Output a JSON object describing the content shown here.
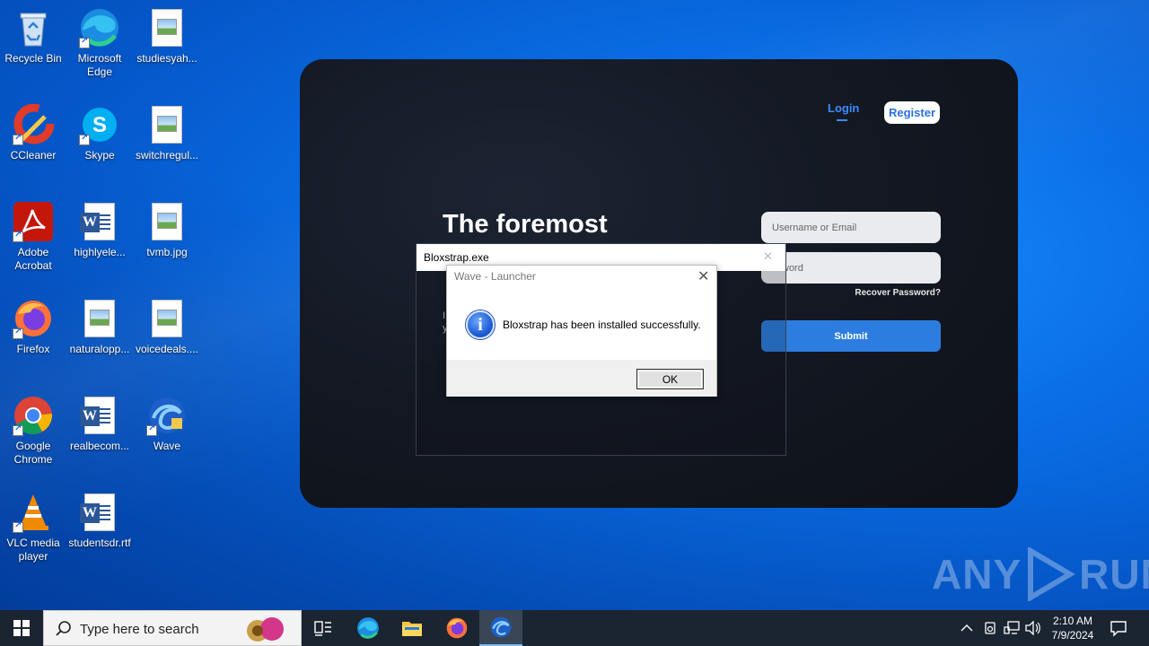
{
  "desktop": {
    "icons": [
      {
        "label": "Recycle Bin"
      },
      {
        "label": "Microsoft Edge"
      },
      {
        "label": "studiesyah..."
      },
      {
        "label": "CCleaner"
      },
      {
        "label": "Skype"
      },
      {
        "label": "switchregul..."
      },
      {
        "label": "Adobe Acrobat"
      },
      {
        "label": "highlyele..."
      },
      {
        "label": "tvmb.jpg"
      },
      {
        "label": "Firefox"
      },
      {
        "label": "naturalopp..."
      },
      {
        "label": "voicedeals...."
      },
      {
        "label": "Google Chrome"
      },
      {
        "label": "realbecom..."
      },
      {
        "label": "Wave"
      },
      {
        "label": "VLC media player"
      },
      {
        "label": "studentsdr.rtf"
      }
    ]
  },
  "launcher": {
    "nav_login": "Login",
    "nav_register": "Register",
    "headline": "The foremost",
    "username_placeholder": "Username or Email",
    "password_placeholder": "ssword",
    "recover": "Recover Password?",
    "submit": "Submit",
    "side_line1": "I",
    "side_line2": "y"
  },
  "bloxstrap_window": {
    "title": "Bloxstrap.exe",
    "close": "✕"
  },
  "message_box": {
    "title": "Wave - Launcher",
    "close": "✕",
    "icon": "i",
    "text": "Bloxstrap has been installed successfully.",
    "ok": "OK"
  },
  "watermark": {
    "left": "ANY",
    "right": "RUN"
  },
  "taskbar": {
    "search_placeholder": "Type here to search",
    "time": "2:10 AM",
    "date": "7/9/2024"
  },
  "colors": {
    "accent": "#2d7de0",
    "desktop": "#0a6ee6",
    "taskbar": "#1b2431"
  }
}
